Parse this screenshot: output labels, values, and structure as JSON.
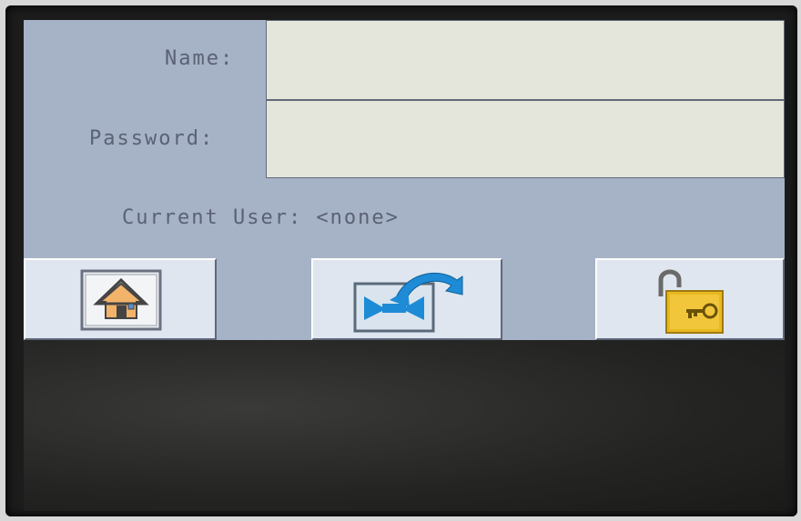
{
  "form": {
    "name_label": "Name:",
    "name_value": "",
    "password_label": "Password:",
    "password_value": "",
    "current_user_text": "Current User: <none>"
  },
  "toolbar": {
    "buttons": [
      {
        "icon": "home-icon"
      },
      {
        "icon": "back-to-process-icon"
      },
      {
        "icon": "unlock-icon"
      }
    ]
  },
  "colors": {
    "panel": "#a6b2c6",
    "field": "#e4e6dc",
    "button": "#dfe6ef",
    "label": "#5a6274",
    "accent_blue": "#1e8bd6",
    "lock_gold": "#e8b820"
  }
}
